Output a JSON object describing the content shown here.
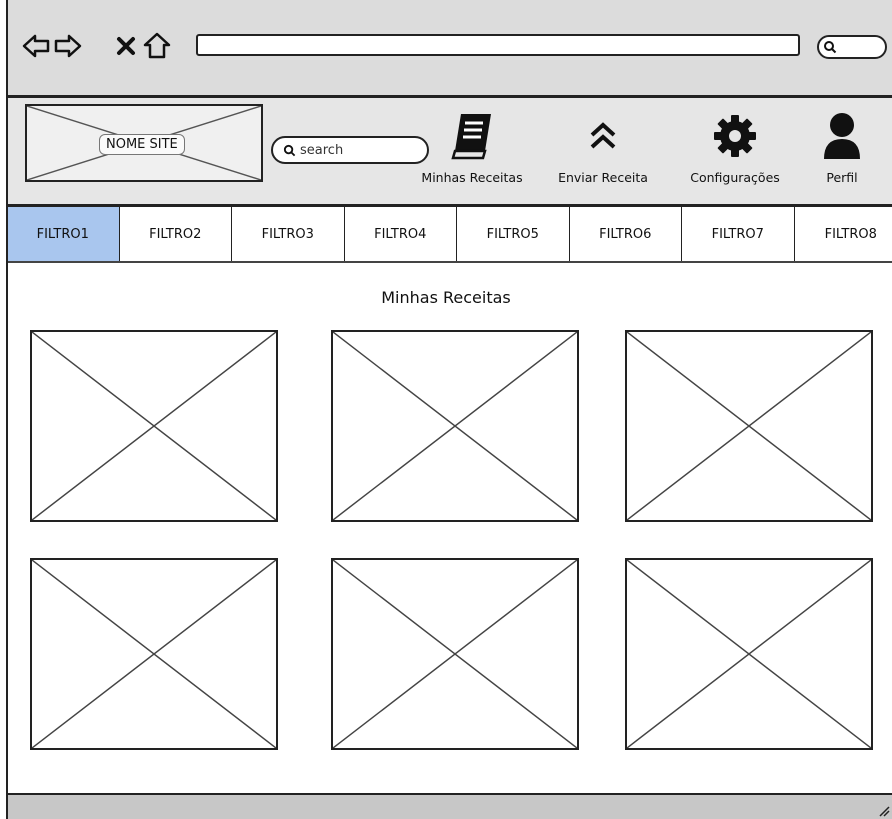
{
  "browser": {
    "icons": [
      "back-arrow-icon",
      "forward-arrow-icon",
      "close-x-icon",
      "home-icon",
      "search-icon"
    ],
    "url": ""
  },
  "header": {
    "logo_label": "NOME SITE",
    "search_placeholder": "search",
    "nav": [
      {
        "label": "Minhas Receitas",
        "icon": "book-icon"
      },
      {
        "label": "Enviar Receita",
        "icon": "double-chevron-up-icon"
      },
      {
        "label": "Configurações",
        "icon": "gear-icon"
      },
      {
        "label": "Perfil",
        "icon": "user-icon"
      }
    ]
  },
  "filters": {
    "items": [
      "FILTRO1",
      "FILTRO2",
      "FILTRO3",
      "FILTRO4",
      "FILTRO5",
      "FILTRO6",
      "FILTRO7",
      "FILTRO8"
    ],
    "active": "FILTRO1",
    "active_color": "#a9c6ee"
  },
  "main": {
    "title": "Minhas Receitas",
    "cards": [
      "image-placeholder",
      "image-placeholder",
      "image-placeholder",
      "image-placeholder",
      "image-placeholder",
      "image-placeholder"
    ]
  }
}
